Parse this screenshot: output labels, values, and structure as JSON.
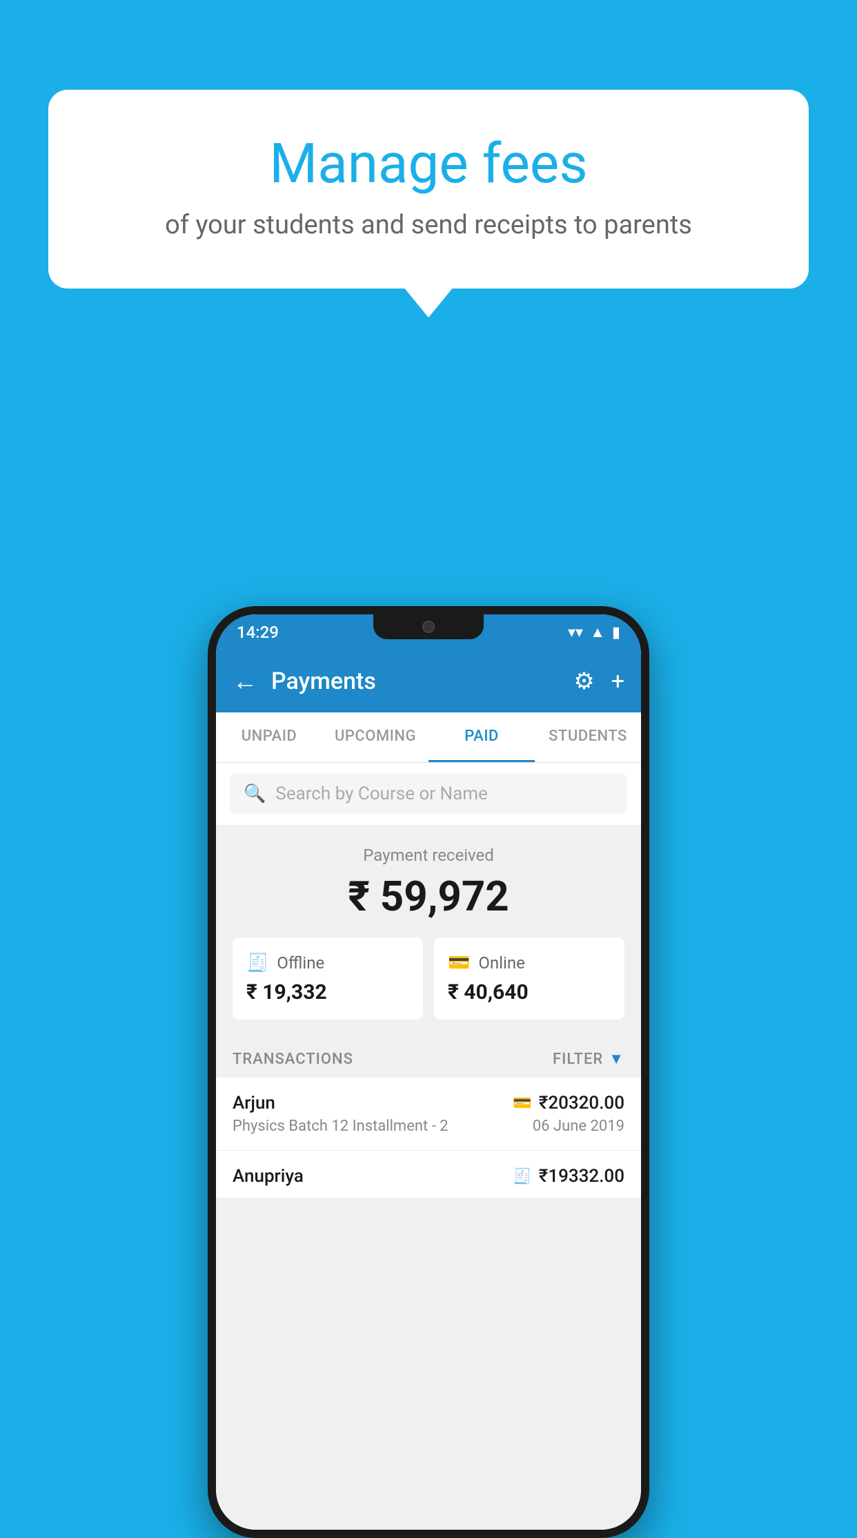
{
  "background_color": "#1AAFE8",
  "speech_bubble": {
    "title": "Manage fees",
    "subtitle": "of your students and send receipts to parents"
  },
  "phone": {
    "status_bar": {
      "time": "14:29",
      "icons": [
        "wifi",
        "signal",
        "battery"
      ]
    },
    "app_bar": {
      "title": "Payments",
      "back_label": "←",
      "settings_label": "⚙",
      "plus_label": "+"
    },
    "tabs": [
      {
        "label": "UNPAID",
        "active": false
      },
      {
        "label": "UPCOMING",
        "active": false
      },
      {
        "label": "PAID",
        "active": true
      },
      {
        "label": "STUDENTS",
        "active": false
      }
    ],
    "search": {
      "placeholder": "Search by Course or Name"
    },
    "payment_summary": {
      "label": "Payment received",
      "amount": "₹ 59,972",
      "offline": {
        "label": "Offline",
        "amount": "₹ 19,332"
      },
      "online": {
        "label": "Online",
        "amount": "₹ 40,640"
      }
    },
    "transactions_section": {
      "label": "TRANSACTIONS",
      "filter_label": "FILTER"
    },
    "transactions": [
      {
        "name": "Arjun",
        "amount": "₹20320.00",
        "course": "Physics Batch 12 Installment - 2",
        "date": "06 June 2019",
        "payment_type": "online"
      },
      {
        "name": "Anupriya",
        "amount": "₹19332.00",
        "course": "",
        "date": "",
        "payment_type": "offline"
      }
    ]
  }
}
